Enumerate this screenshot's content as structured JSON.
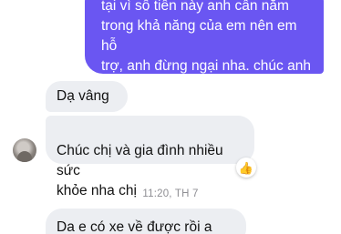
{
  "messages": {
    "outgoing_1": "tại vì số tiền này anh cần nắm\ntrong khả năng của em nên em hỗ\ntrợ, anh đừng ngại nha. chúc anh\nvề nhà thành công ạ",
    "incoming_1": "Dạ vâng",
    "incoming_2": "Chúc chị và gia đình nhiều sức\nkhỏe nha chị",
    "incoming_3": "Da e có xe về được rồi a"
  },
  "reaction": {
    "emoji": "👍",
    "icon": "thumbs-up-icon"
  },
  "timestamp": "11:20, TH 7",
  "colors": {
    "outgoing_bubble": "#6a56f2",
    "incoming_bubble": "#eceef2",
    "timestamp_text": "#8e8e93"
  }
}
